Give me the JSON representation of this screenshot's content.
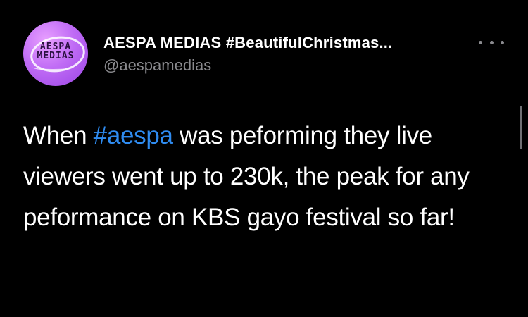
{
  "tweet": {
    "avatar": {
      "logo_line1": "AESPA",
      "logo_line2": "MEDIAS"
    },
    "display_name": "AESPA MEDIAS #BeautifulChristmas...",
    "handle": "@aespamedias",
    "more_icon": "ellipsis-icon",
    "body": {
      "part1": "When ",
      "hashtag": "#aespa",
      "part2": " was peforming they live viewers went up to 230k, the peak for any peformance on KBS gayo festival so far!"
    }
  },
  "colors": {
    "background": "#000000",
    "text": "#ffffff",
    "secondary": "#8b8b8f",
    "link": "#2f8cf1",
    "avatar_accent": "#c06cf5"
  }
}
